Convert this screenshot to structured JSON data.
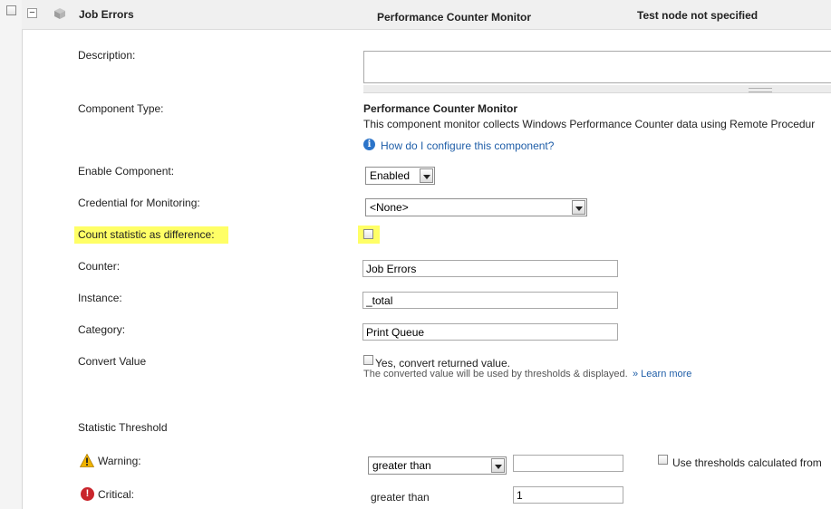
{
  "header": {
    "title": "Job Errors",
    "component_type": "Performance Counter Monitor",
    "test_node": "Test node not specified",
    "collapse_symbol": "−"
  },
  "form": {
    "description": {
      "label": "Description:",
      "value": ""
    },
    "component_type": {
      "label": "Component Type:",
      "name": "Performance Counter Monitor",
      "description": "This component monitor collects Windows Performance Counter data using Remote Procedur",
      "help_link": "How do I configure this component?",
      "help_icon": "info-icon"
    },
    "enable_component": {
      "label": "Enable Component:",
      "selected": "Enabled"
    },
    "credential": {
      "label": "Credential for Monitoring:",
      "selected": "<None>"
    },
    "count_statistic": {
      "label": "Count statistic as difference:",
      "checked": false
    },
    "counter": {
      "label": "Counter:",
      "value": "Job Errors"
    },
    "instance": {
      "label": "Instance:",
      "value": "_total"
    },
    "category": {
      "label": "Category:",
      "value": "Print Queue"
    },
    "convert_value": {
      "label": "Convert Value",
      "checkbox_label": "Yes, convert returned value.",
      "hint": "The converted value will be used by thresholds & displayed.",
      "learn_more": "» Learn more"
    }
  },
  "threshold": {
    "section_label": "Statistic Threshold",
    "warning": {
      "label": "Warning:",
      "operator": "greater than",
      "value": "",
      "icon": "warning-icon"
    },
    "critical": {
      "label": "Critical:",
      "operator": "greater than",
      "value": "1",
      "icon": "error-icon"
    },
    "use_thresholds_label": "Use thresholds calculated from"
  },
  "colors": {
    "highlight": "#ffff66",
    "link": "#1f5ea8",
    "info_icon": "#2b74c9",
    "critical_icon": "#c9252c",
    "warning_icon": "#f0b400"
  }
}
